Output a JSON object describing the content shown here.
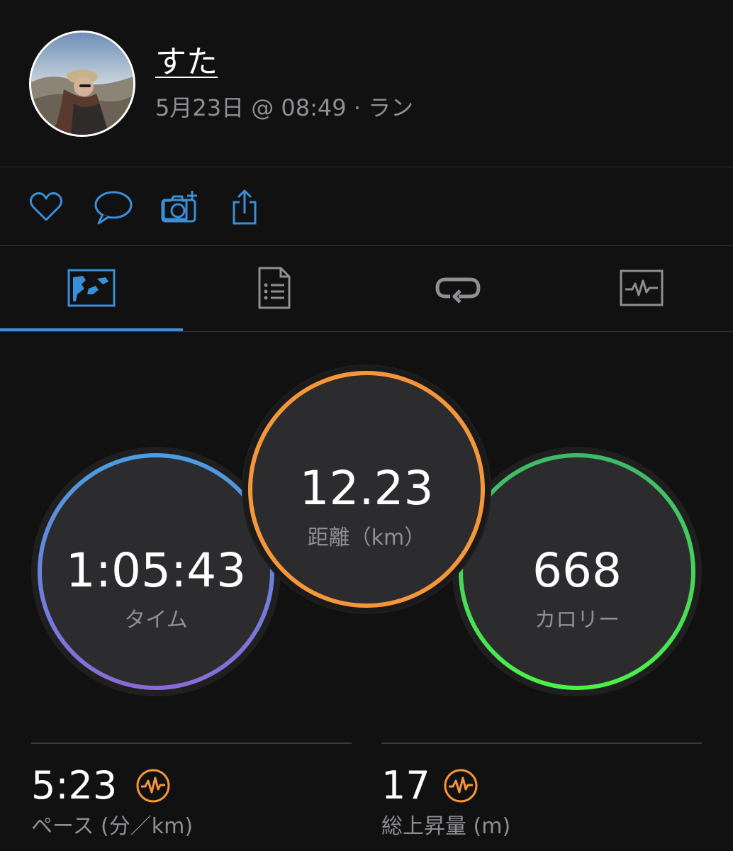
{
  "header": {
    "username": "すた",
    "subtitle": "5月23日 @ 08:49 · ラン"
  },
  "actions": [
    {
      "icon": "heart-icon"
    },
    {
      "icon": "comment-icon"
    },
    {
      "icon": "add-photo-icon"
    },
    {
      "icon": "share-icon"
    }
  ],
  "tabs": [
    {
      "icon": "map-icon",
      "selected": true
    },
    {
      "icon": "details-list-icon",
      "selected": false
    },
    {
      "icon": "laps-icon",
      "selected": false
    },
    {
      "icon": "chart-icon",
      "selected": false
    }
  ],
  "summary": {
    "time": {
      "value": "1:05:43",
      "label": "タイム"
    },
    "distance": {
      "value": "12.23",
      "label": "距離（km）"
    },
    "calories": {
      "value": "668",
      "label": "カロリー"
    }
  },
  "stats": {
    "pace": {
      "value": "5:23",
      "label": "ペース (分／km)"
    },
    "elevation": {
      "value": "17",
      "label": "総上昇量 (m)"
    }
  },
  "colors": {
    "accent": "#3a8fd8",
    "time_ring_top": "#4a9de0",
    "time_ring_bottom": "#8a6ad8",
    "distance_ring": "#f5963a",
    "calories_ring_top": "#3fb86a",
    "calories_ring_bottom": "#4cf04a",
    "badge": "#f5963a"
  }
}
